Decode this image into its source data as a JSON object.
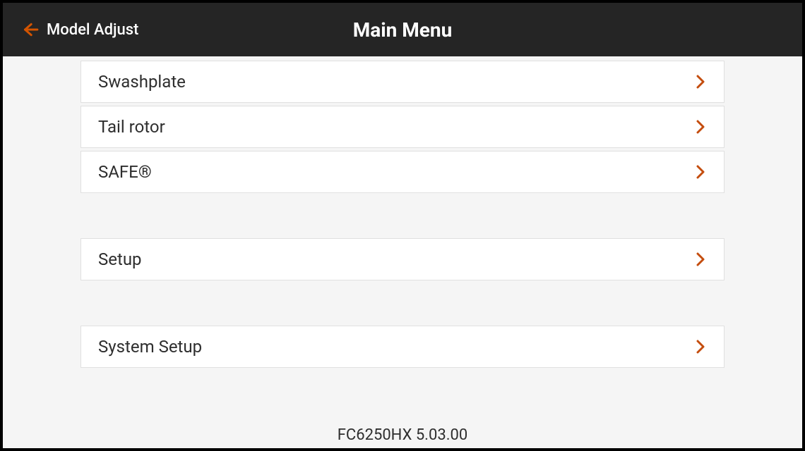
{
  "header": {
    "back_label": "Model Adjust",
    "title": "Main Menu"
  },
  "menu": {
    "group1": [
      {
        "label": "Swashplate"
      },
      {
        "label": "Tail rotor"
      },
      {
        "label": "SAFE®"
      }
    ],
    "group2": [
      {
        "label": "Setup"
      }
    ],
    "group3": [
      {
        "label": "System Setup"
      }
    ]
  },
  "footer": {
    "version": "FC6250HX 5.03.00"
  }
}
